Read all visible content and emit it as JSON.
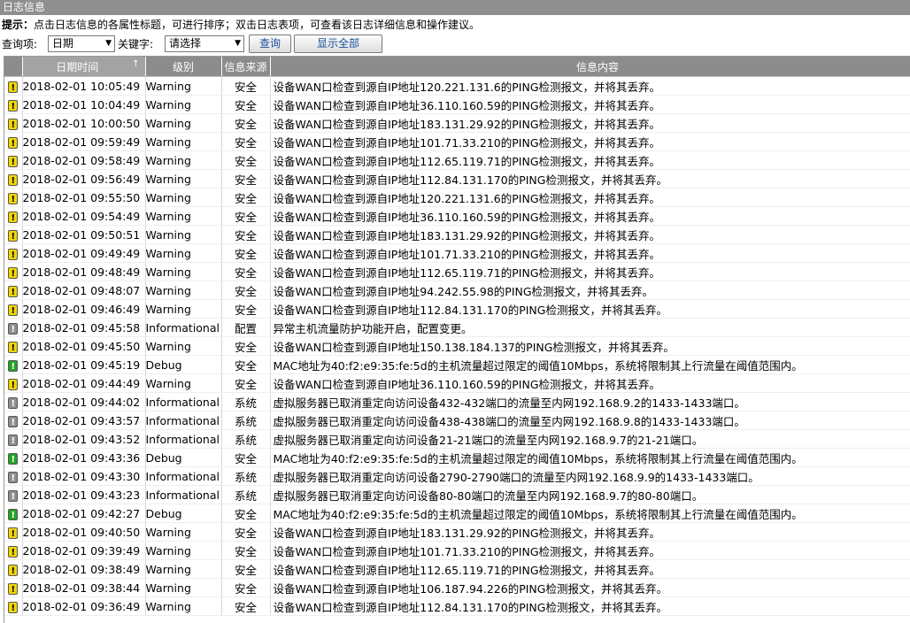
{
  "window": {
    "title": "日志信息"
  },
  "hint": {
    "label": "提示：",
    "text": "点击日志信息的各属性标题，可进行排序；双击日志表项，可查看该日志详细信息和操作建议。"
  },
  "query": {
    "field_label": "查询项:",
    "field_value": "日期",
    "keyword_label": "关键字:",
    "keyword_value": "请选择",
    "search_button": "查询",
    "show_all_button": "显示全部"
  },
  "table": {
    "columns": [
      "日期时间",
      "级别",
      "信息来源",
      "信息内容"
    ],
    "sort_indicator": "↑",
    "rows": [
      {
        "level_icon": "warning",
        "time": "2018-02-01 10:05:49",
        "level": "Warning",
        "source": "安全",
        "message": "设备WAN口检查到源自IP地址120.221.131.6的PING检测报文，并将其丢弃。"
      },
      {
        "level_icon": "warning",
        "time": "2018-02-01 10:04:49",
        "level": "Warning",
        "source": "安全",
        "message": "设备WAN口检查到源自IP地址36.110.160.59的PING检测报文，并将其丢弃。"
      },
      {
        "level_icon": "warning",
        "time": "2018-02-01 10:00:50",
        "level": "Warning",
        "source": "安全",
        "message": "设备WAN口检查到源自IP地址183.131.29.92的PING检测报文，并将其丢弃。"
      },
      {
        "level_icon": "warning",
        "time": "2018-02-01 09:59:49",
        "level": "Warning",
        "source": "安全",
        "message": "设备WAN口检查到源自IP地址101.71.33.210的PING检测报文，并将其丢弃。"
      },
      {
        "level_icon": "warning",
        "time": "2018-02-01 09:58:49",
        "level": "Warning",
        "source": "安全",
        "message": "设备WAN口检查到源自IP地址112.65.119.71的PING检测报文，并将其丢弃。"
      },
      {
        "level_icon": "warning",
        "time": "2018-02-01 09:56:49",
        "level": "Warning",
        "source": "安全",
        "message": "设备WAN口检查到源自IP地址112.84.131.170的PING检测报文，并将其丢弃。"
      },
      {
        "level_icon": "warning",
        "time": "2018-02-01 09:55:50",
        "level": "Warning",
        "source": "安全",
        "message": "设备WAN口检查到源自IP地址120.221.131.6的PING检测报文，并将其丢弃。"
      },
      {
        "level_icon": "warning",
        "time": "2018-02-01 09:54:49",
        "level": "Warning",
        "source": "安全",
        "message": "设备WAN口检查到源自IP地址36.110.160.59的PING检测报文，并将其丢弃。"
      },
      {
        "level_icon": "warning",
        "time": "2018-02-01 09:50:51",
        "level": "Warning",
        "source": "安全",
        "message": "设备WAN口检查到源自IP地址183.131.29.92的PING检测报文，并将其丢弃。"
      },
      {
        "level_icon": "warning",
        "time": "2018-02-01 09:49:49",
        "level": "Warning",
        "source": "安全",
        "message": "设备WAN口检查到源自IP地址101.71.33.210的PING检测报文，并将其丢弃。"
      },
      {
        "level_icon": "warning",
        "time": "2018-02-01 09:48:49",
        "level": "Warning",
        "source": "安全",
        "message": "设备WAN口检查到源自IP地址112.65.119.71的PING检测报文，并将其丢弃。"
      },
      {
        "level_icon": "warning",
        "time": "2018-02-01 09:48:07",
        "level": "Warning",
        "source": "安全",
        "message": "设备WAN口检查到源自IP地址94.242.55.98的PING检测报文，并将其丢弃。"
      },
      {
        "level_icon": "warning",
        "time": "2018-02-01 09:46:49",
        "level": "Warning",
        "source": "安全",
        "message": "设备WAN口检查到源自IP地址112.84.131.170的PING检测报文，并将其丢弃。"
      },
      {
        "level_icon": "info",
        "time": "2018-02-01 09:45:58",
        "level": "Informational",
        "source": "配置",
        "message": "异常主机流量防护功能开启，配置变更。"
      },
      {
        "level_icon": "warning",
        "time": "2018-02-01 09:45:50",
        "level": "Warning",
        "source": "安全",
        "message": "设备WAN口检查到源自IP地址150.138.184.137的PING检测报文，并将其丢弃。"
      },
      {
        "level_icon": "debug",
        "time": "2018-02-01 09:45:19",
        "level": "Debug",
        "source": "安全",
        "message": "MAC地址为40:f2:e9:35:fe:5d的主机流量超过限定的阈值10Mbps，系统将限制其上行流量在阈值范围内。"
      },
      {
        "level_icon": "warning",
        "time": "2018-02-01 09:44:49",
        "level": "Warning",
        "source": "安全",
        "message": "设备WAN口检查到源自IP地址36.110.160.59的PING检测报文，并将其丢弃。"
      },
      {
        "level_icon": "info",
        "time": "2018-02-01 09:44:02",
        "level": "Informational",
        "source": "系统",
        "message": "虚拟服务器已取消重定向访问设备432-432端口的流量至内网192.168.9.2的1433-1433端口。"
      },
      {
        "level_icon": "info",
        "time": "2018-02-01 09:43:57",
        "level": "Informational",
        "source": "系统",
        "message": "虚拟服务器已取消重定向访问设备438-438端口的流量至内网192.168.9.8的1433-1433端口。"
      },
      {
        "level_icon": "info",
        "time": "2018-02-01 09:43:52",
        "level": "Informational",
        "source": "系统",
        "message": "虚拟服务器已取消重定向访问设备21-21端口的流量至内网192.168.9.7的21-21端口。"
      },
      {
        "level_icon": "debug",
        "time": "2018-02-01 09:43:36",
        "level": "Debug",
        "source": "安全",
        "message": "MAC地址为40:f2:e9:35:fe:5d的主机流量超过限定的阈值10Mbps，系统将限制其上行流量在阈值范围内。"
      },
      {
        "level_icon": "info",
        "time": "2018-02-01 09:43:30",
        "level": "Informational",
        "source": "系统",
        "message": "虚拟服务器已取消重定向访问设备2790-2790端口的流量至内网192.168.9.9的1433-1433端口。"
      },
      {
        "level_icon": "info",
        "time": "2018-02-01 09:43:23",
        "level": "Informational",
        "source": "系统",
        "message": "虚拟服务器已取消重定向访问设备80-80端口的流量至内网192.168.9.7的80-80端口。"
      },
      {
        "level_icon": "debug",
        "time": "2018-02-01 09:42:27",
        "level": "Debug",
        "source": "安全",
        "message": "MAC地址为40:f2:e9:35:fe:5d的主机流量超过限定的阈值10Mbps，系统将限制其上行流量在阈值范围内。"
      },
      {
        "level_icon": "warning",
        "time": "2018-02-01 09:40:50",
        "level": "Warning",
        "source": "安全",
        "message": "设备WAN口检查到源自IP地址183.131.29.92的PING检测报文，并将其丢弃。"
      },
      {
        "level_icon": "warning",
        "time": "2018-02-01 09:39:49",
        "level": "Warning",
        "source": "安全",
        "message": "设备WAN口检查到源自IP地址101.71.33.210的PING检测报文，并将其丢弃。"
      },
      {
        "level_icon": "warning",
        "time": "2018-02-01 09:38:49",
        "level": "Warning",
        "source": "安全",
        "message": "设备WAN口检查到源自IP地址112.65.119.71的PING检测报文，并将其丢弃。"
      },
      {
        "level_icon": "warning",
        "time": "2018-02-01 09:38:44",
        "level": "Warning",
        "source": "安全",
        "message": "设备WAN口检查到源自IP地址106.187.94.226的PING检测报文，并将其丢弃。"
      },
      {
        "level_icon": "warning",
        "time": "2018-02-01 09:36:49",
        "level": "Warning",
        "source": "安全",
        "message": "设备WAN口检查到源自IP地址112.84.131.170的PING检测报文，并将其丢弃。"
      }
    ]
  }
}
